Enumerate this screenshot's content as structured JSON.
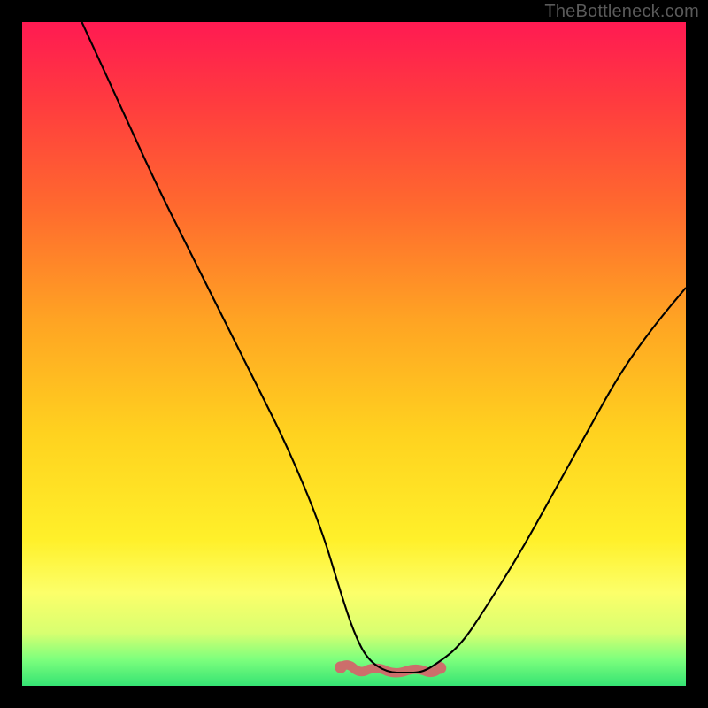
{
  "watermark": "TheBottleneck.com",
  "chart_data": {
    "type": "line",
    "title": "",
    "xlabel": "",
    "ylabel": "",
    "xlim": [
      0,
      100
    ],
    "ylim": [
      0,
      100
    ],
    "grid": false,
    "series": [
      {
        "name": "bottleneck-curve",
        "x": [
          9,
          15,
          20,
          25,
          30,
          35,
          40,
          45,
          48,
          50,
          52,
          55,
          58,
          60,
          62,
          66,
          70,
          75,
          80,
          85,
          90,
          95,
          100
        ],
        "y": [
          100,
          87,
          76,
          66,
          56,
          46,
          36,
          24,
          14,
          8,
          4,
          2,
          2,
          2,
          3,
          6,
          12,
          20,
          29,
          38,
          47,
          54,
          60
        ]
      }
    ],
    "annotations": [
      {
        "name": "optimal-range-marker",
        "x_start": 48,
        "x_end": 63,
        "y": 3
      }
    ],
    "colors": {
      "curve": "#000000",
      "marker": "#cc6e6b",
      "gradient_top": "#ff1a52",
      "gradient_bottom": "#35e373"
    }
  }
}
